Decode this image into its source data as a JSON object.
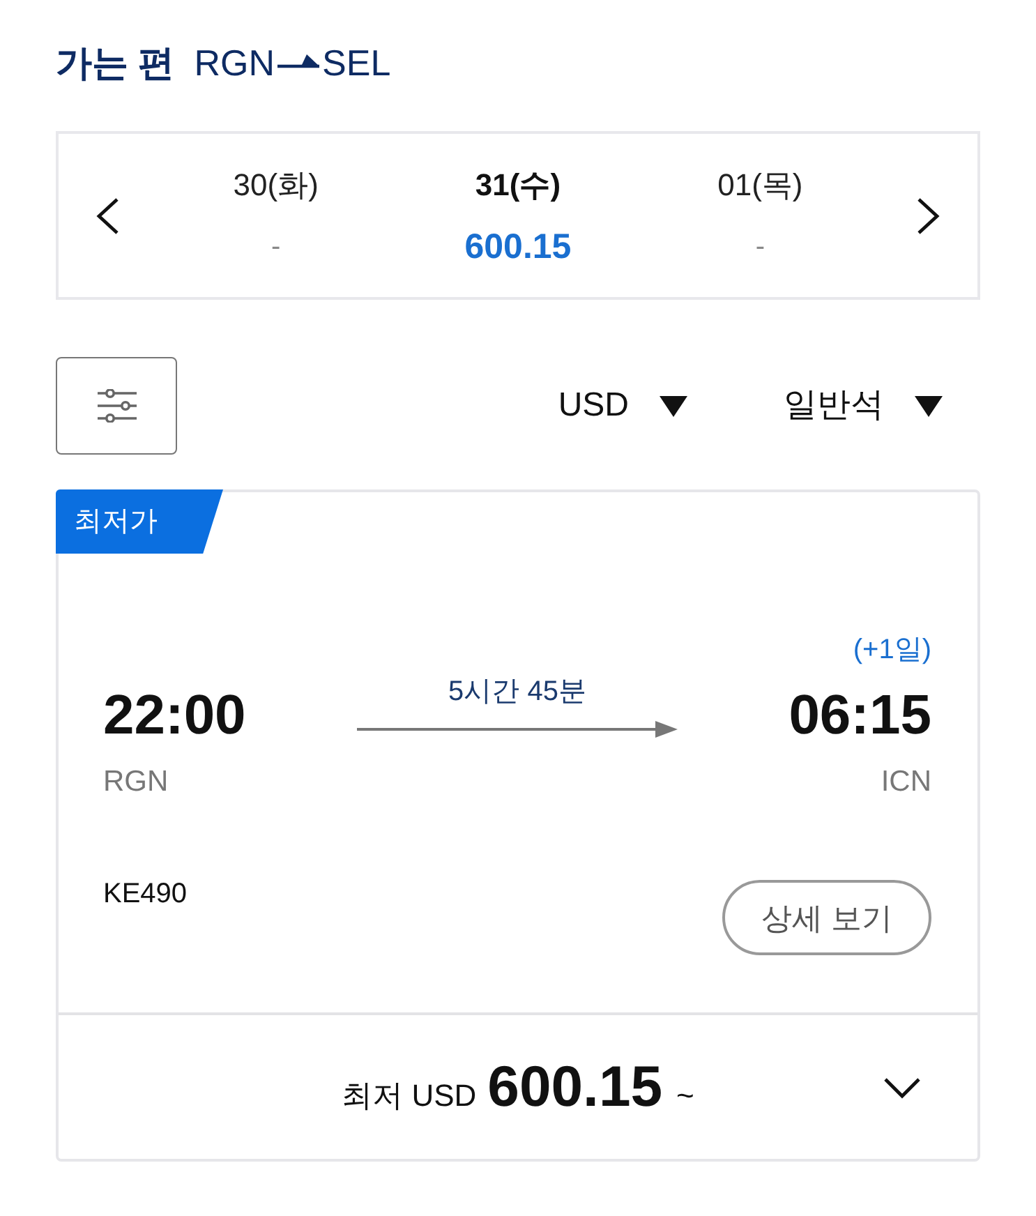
{
  "header": {
    "title": "가는 편",
    "origin": "RGN",
    "destination": "SEL"
  },
  "dates": [
    {
      "label": "30(화)",
      "price": "-",
      "selected": false
    },
    {
      "label": "31(수)",
      "price": "600.15",
      "selected": true
    },
    {
      "label": "01(목)",
      "price": "-",
      "selected": false
    }
  ],
  "filters": {
    "currency": "USD",
    "cabin": "일반석"
  },
  "flights": [
    {
      "badge": "최저가",
      "departure": {
        "time": "22:00",
        "airport": "RGN"
      },
      "duration": "5시간 45분",
      "arrival": {
        "day_offset": "(+1일)",
        "time": "06:15",
        "airport": "ICN"
      },
      "flight_number": "KE490",
      "details_button": "상세 보기",
      "fare": {
        "prefix": "최저 USD",
        "amount": "600.15",
        "suffix": "~"
      },
      "expanded": false
    }
  ]
}
